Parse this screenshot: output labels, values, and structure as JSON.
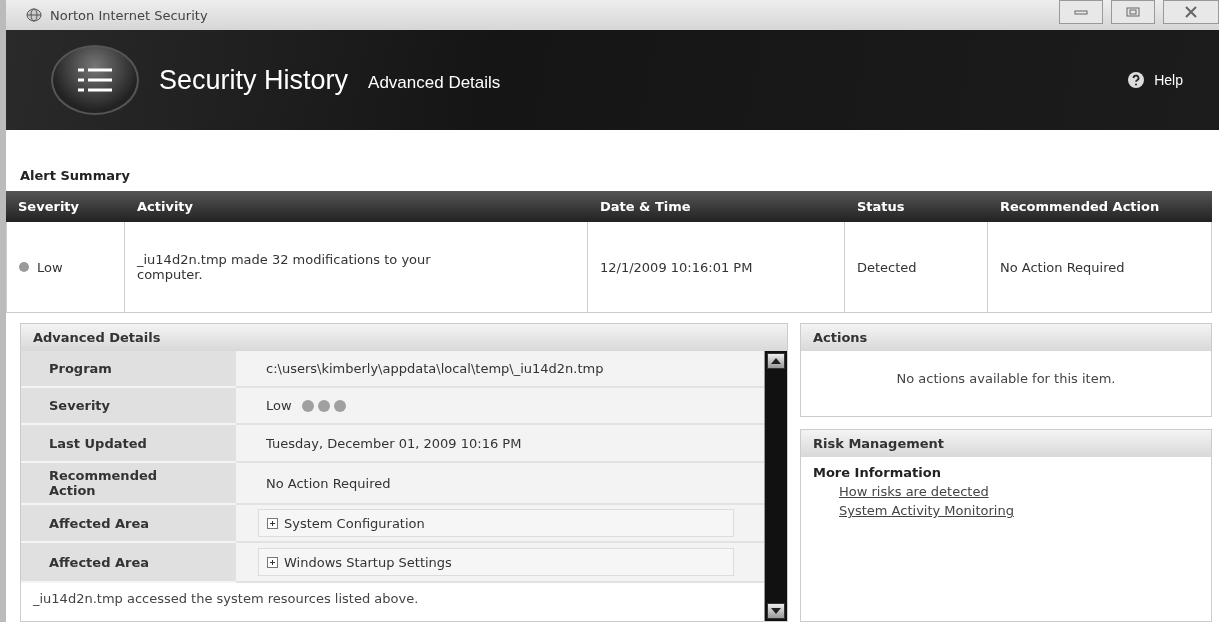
{
  "window": {
    "title": "Norton Internet Security"
  },
  "header": {
    "title": "Security History",
    "subtitle": "Advanced Details",
    "help": "Help"
  },
  "alert_summary": {
    "title": "Alert Summary",
    "columns": [
      "Severity",
      "Activity",
      "Date & Time",
      "Status",
      "Recommended Action"
    ],
    "rows": [
      {
        "severity": "Low",
        "activity": "_iu14d2n.tmp made 32 modifications to your computer.",
        "date_time": "12/1/2009 10:16:01 PM",
        "status": "Detected",
        "recommended_action": "No Action Required"
      }
    ]
  },
  "advanced_details": {
    "title": "Advanced Details",
    "rows": [
      {
        "kind": "text",
        "label": "Program",
        "value": "c:\\users\\kimberly\\appdata\\local\\temp\\_iu14d2n.tmp"
      },
      {
        "kind": "severity",
        "label": "Severity",
        "value": "Low"
      },
      {
        "kind": "text",
        "label": "Last Updated",
        "value": "Tuesday, December 01, 2009 10:16 PM"
      },
      {
        "kind": "text",
        "label": "Recommended Action",
        "value": "No Action Required"
      },
      {
        "kind": "tree",
        "label": "Affected Area",
        "value": "System Configuration",
        "expanded": false
      },
      {
        "kind": "tree",
        "label": "Affected Area",
        "value": "Windows Startup Settings",
        "expanded": false
      }
    ],
    "footer": "_iu14d2n.tmp accessed the system resources listed above."
  },
  "actions": {
    "title": "Actions",
    "message": "No actions available for this item."
  },
  "risk_management": {
    "title": "Risk Management",
    "subtitle": "More Information",
    "links": [
      "How risks are detected",
      "System Activity Monitoring"
    ]
  }
}
